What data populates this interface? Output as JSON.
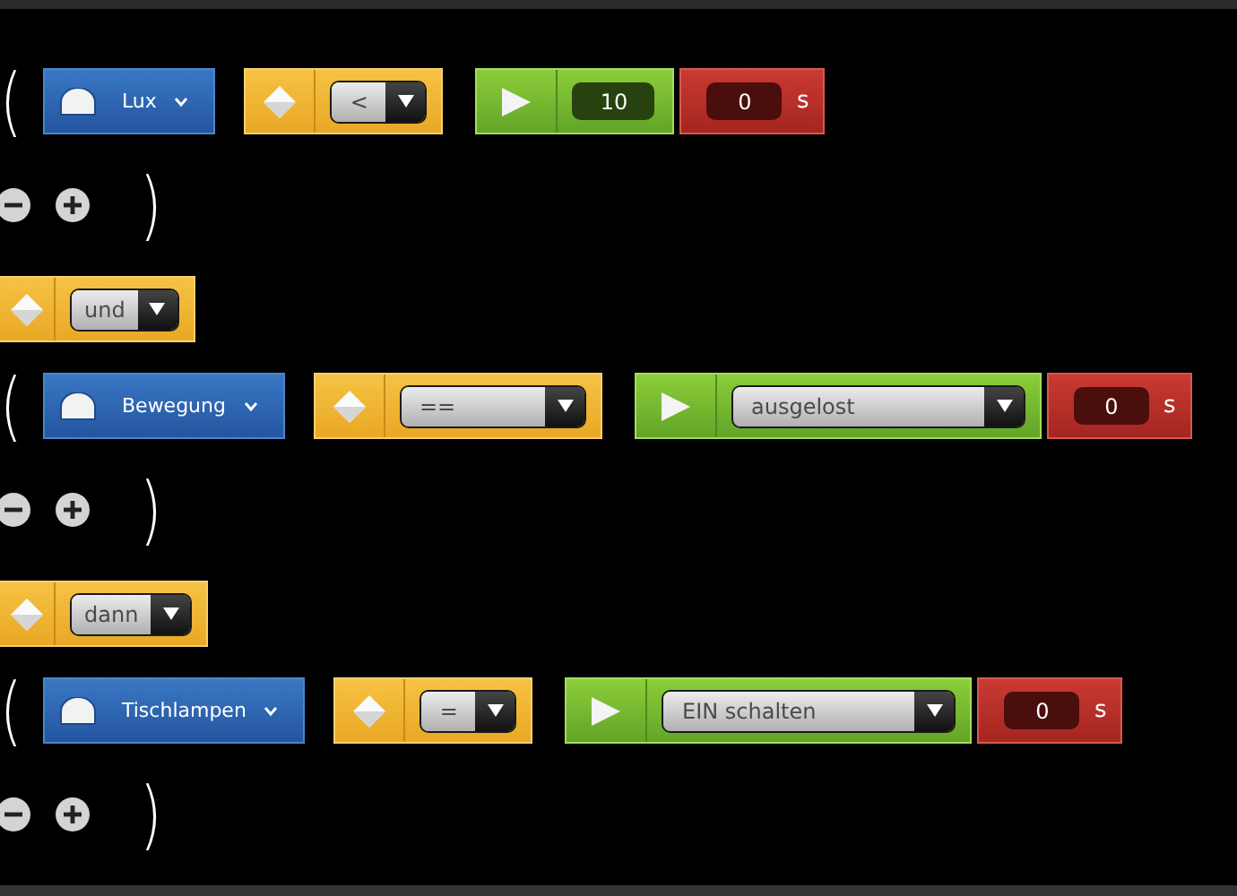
{
  "rows": [
    {
      "kind": "condition",
      "open": "(",
      "device": {
        "label": "Lux"
      },
      "operator": {
        "value": "<"
      },
      "target": {
        "kind": "number",
        "value": "10"
      },
      "delay": {
        "value": "0",
        "unit": "s"
      }
    },
    {
      "kind": "group_controls",
      "close": ")"
    },
    {
      "kind": "connector",
      "value": "und"
    },
    {
      "kind": "condition",
      "open": "(",
      "device": {
        "label": "Bewegung"
      },
      "operator": {
        "value": "=="
      },
      "target": {
        "kind": "select",
        "value": "ausgelost"
      },
      "delay": {
        "value": "0",
        "unit": "s"
      }
    },
    {
      "kind": "group_controls",
      "close": ")"
    },
    {
      "kind": "connector",
      "value": "dann"
    },
    {
      "kind": "condition",
      "open": "(",
      "device": {
        "label": "Tischlampen"
      },
      "operator": {
        "value": "="
      },
      "target": {
        "kind": "select",
        "value": "EIN schalten"
      },
      "delay": {
        "value": "0",
        "unit": "s"
      }
    },
    {
      "kind": "group_controls",
      "close": ")"
    }
  ]
}
